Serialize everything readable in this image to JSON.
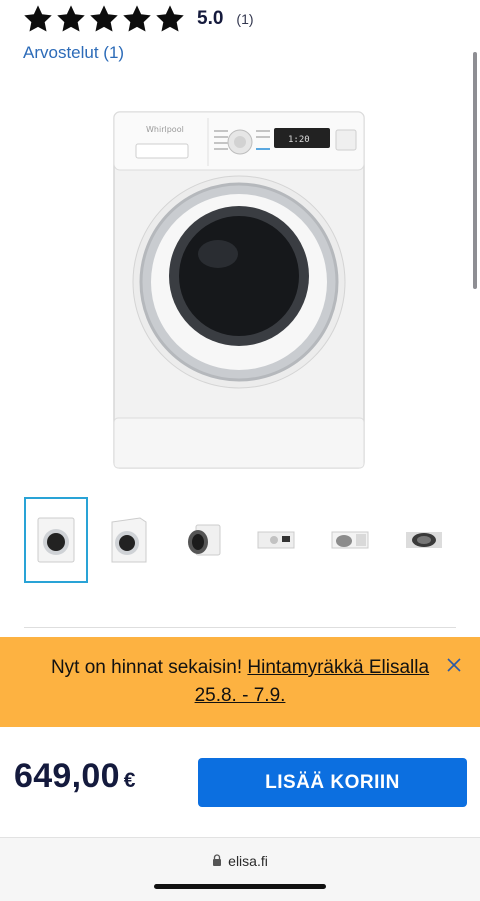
{
  "rating": {
    "score": "5.0",
    "count": "(1)",
    "star_icon": "star-icon",
    "reviews_link": "Arvostelut (1)"
  },
  "product": {
    "main_image": "washing-machine-image",
    "brand_on_image": "Whirlpool",
    "thumbnails": [
      {
        "name": "thumbnail-front",
        "active": true
      },
      {
        "name": "thumbnail-angle",
        "active": false
      },
      {
        "name": "thumbnail-side",
        "active": false
      },
      {
        "name": "thumbnail-panel",
        "active": false
      },
      {
        "name": "thumbnail-door-open",
        "active": false
      },
      {
        "name": "thumbnail-drum",
        "active": false
      }
    ]
  },
  "promo": {
    "text": "Nyt on hinnat sekaisin! ",
    "link": "Hintamyräkkä Elisalla 25.8. - 7.9.",
    "close_icon": "close-icon",
    "background": "#fdb241"
  },
  "purchase": {
    "price": "649,00",
    "currency": "€",
    "add_to_cart": "LISÄÄ KORIIN",
    "button_color": "#0c6fe0"
  },
  "browser": {
    "url": "elisa.fi",
    "lock_icon": "lock-icon"
  }
}
